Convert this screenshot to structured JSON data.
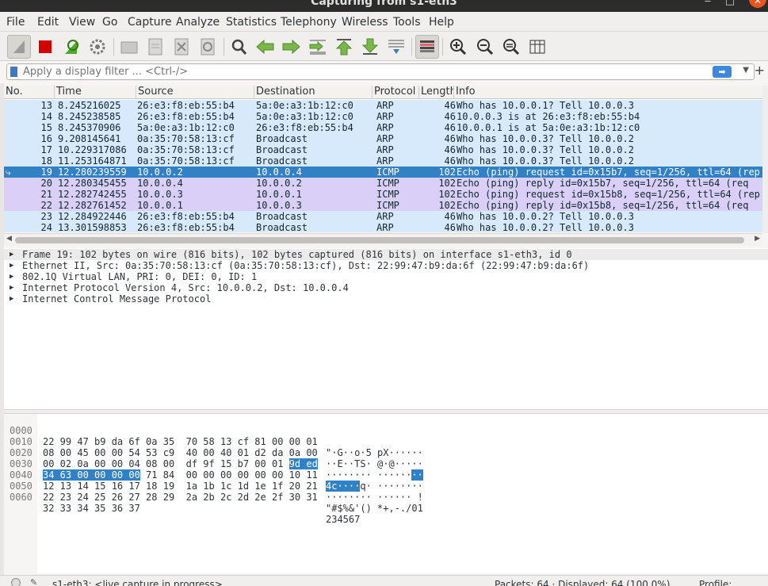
{
  "window": {
    "title": "Capturing from s1-eth3"
  },
  "menu": [
    "File",
    "Edit",
    "View",
    "Go",
    "Capture",
    "Analyze",
    "Statistics",
    "Telephony",
    "Wireless",
    "Tools",
    "Help"
  ],
  "filter": {
    "placeholder": "Apply a display filter ... <Ctrl-/>"
  },
  "columns": [
    "No.",
    "Time",
    "Source",
    "Destination",
    "Protocol",
    "Length",
    "Info"
  ],
  "packets": [
    {
      "no": "13",
      "time": "8.245216025",
      "src": "26:e3:f8:eb:55:b4",
      "dst": "5a:0e:a3:1b:12:c0",
      "proto": "ARP",
      "len": "46",
      "info": "Who has 10.0.0.1? Tell 10.0.0.3"
    },
    {
      "no": "14",
      "time": "8.245238585",
      "src": "26:e3:f8:eb:55:b4",
      "dst": "5a:0e:a3:1b:12:c0",
      "proto": "ARP",
      "len": "46",
      "info": "10.0.0.3 is at 26:e3:f8:eb:55:b4"
    },
    {
      "no": "15",
      "time": "8.245370906",
      "src": "5a:0e:a3:1b:12:c0",
      "dst": "26:e3:f8:eb:55:b4",
      "proto": "ARP",
      "len": "46",
      "info": "10.0.0.1 is at 5a:0e:a3:1b:12:c0"
    },
    {
      "no": "16",
      "time": "9.208145641",
      "src": "0a:35:70:58:13:cf",
      "dst": "Broadcast",
      "proto": "ARP",
      "len": "46",
      "info": "Who has 10.0.0.3? Tell 10.0.0.2"
    },
    {
      "no": "17",
      "time": "10.229317086",
      "src": "0a:35:70:58:13:cf",
      "dst": "Broadcast",
      "proto": "ARP",
      "len": "46",
      "info": "Who has 10.0.0.3? Tell 10.0.0.2"
    },
    {
      "no": "18",
      "time": "11.253164871",
      "src": "0a:35:70:58:13:cf",
      "dst": "Broadcast",
      "proto": "ARP",
      "len": "46",
      "info": "Who has 10.0.0.3? Tell 10.0.0.2"
    },
    {
      "no": "19",
      "time": "12.280239559",
      "src": "10.0.0.2",
      "dst": "10.0.0.4",
      "proto": "ICMP",
      "len": "102",
      "info": "Echo (ping) request  id=0x15b7, seq=1/256, ttl=64 (rep"
    },
    {
      "no": "20",
      "time": "12.280345455",
      "src": "10.0.0.4",
      "dst": "10.0.0.2",
      "proto": "ICMP",
      "len": "102",
      "info": "Echo (ping) reply    id=0x15b7, seq=1/256, ttl=64 (req"
    },
    {
      "no": "21",
      "time": "12.282742455",
      "src": "10.0.0.3",
      "dst": "10.0.0.1",
      "proto": "ICMP",
      "len": "102",
      "info": "Echo (ping) request  id=0x15b8, seq=1/256, ttl=64 (rep"
    },
    {
      "no": "22",
      "time": "12.282761452",
      "src": "10.0.0.1",
      "dst": "10.0.0.3",
      "proto": "ICMP",
      "len": "102",
      "info": "Echo (ping) reply    id=0x15b8, seq=1/256, ttl=64 (req"
    },
    {
      "no": "23",
      "time": "12.284922446",
      "src": "26:e3:f8:eb:55:b4",
      "dst": "Broadcast",
      "proto": "ARP",
      "len": "46",
      "info": "Who has 10.0.0.2? Tell 10.0.0.3"
    },
    {
      "no": "24",
      "time": "13.301598853",
      "src": "26:e3:f8:eb:55:b4",
      "dst": "Broadcast",
      "proto": "ARP",
      "len": "46",
      "info": "Who has 10.0.0.2? Tell 10.0.0.3"
    }
  ],
  "selected_packet": "19",
  "details": [
    "Frame 19: 102 bytes on wire (816 bits), 102 bytes captured (816 bits) on interface s1-eth3, id 0",
    "Ethernet II, Src: 0a:35:70:58:13:cf (0a:35:70:58:13:cf), Dst: 22:99:47:b9:da:6f (22:99:47:b9:da:6f)",
    "802.1Q Virtual LAN, PRI: 0, DEI: 0, ID: 1",
    "Internet Protocol Version 4, Src: 10.0.0.2, Dst: 10.0.0.4",
    "Internet Control Message Protocol"
  ],
  "bytes": [
    {
      "off": "0000",
      "hex": "22 99 47 b9 da 6f 0a 35  70 58 13 cf 81 00 00 01",
      "asc": "\"·G··o·5 pX······"
    },
    {
      "off": "0010",
      "hex": "08 00 45 00 00 54 53 c9  40 00 40 01 d2 da 0a 00",
      "asc": "··E··TS· @·@·····"
    },
    {
      "off": "0020",
      "hex": "00 02 0a 00 00 04 08 00  df 9f 15 b7 00 01 ",
      "hex_hl": "9d ed",
      "asc": "········ ······",
      "asc_hl": "··"
    },
    {
      "off": "0030",
      "hex_hl": "34 63 00 00 00 00",
      "hex": " 71 84  00 00 00 00 00 00 10 11",
      "asc_hl": "4c····",
      "asc": "q· ········"
    },
    {
      "off": "0040",
      "hex": "12 13 14 15 16 17 18 19  1a 1b 1c 1d 1e 1f 20 21",
      "asc": "········ ······ !"
    },
    {
      "off": "0050",
      "hex": "22 23 24 25 26 27 28 29  2a 2b 2c 2d 2e 2f 30 31",
      "asc": "\"#$%&'() *+,-./01"
    },
    {
      "off": "0060",
      "hex": "32 33 34 35 36 37",
      "asc": "234567"
    }
  ],
  "status": {
    "left": "s1-eth3: <live capture in progress>",
    "packets": "Packets: 64 · Displayed: 64 (100.0%)",
    "profile": "Profile: Default"
  },
  "toolbar_icons": [
    "shark-fin-icon",
    "stop-icon",
    "restart-icon",
    "options-gear-icon",
    "open-file-icon",
    "save-file-icon",
    "close-file-icon",
    "reload-icon",
    "find-icon",
    "go-back-icon",
    "go-forward-icon",
    "go-to-packet-icon",
    "first-packet-icon",
    "last-packet-icon",
    "autoscroll-icon",
    "colorize-icon",
    "zoom-in-icon",
    "zoom-out-icon",
    "zoom-normal-icon",
    "resize-columns-icon"
  ]
}
